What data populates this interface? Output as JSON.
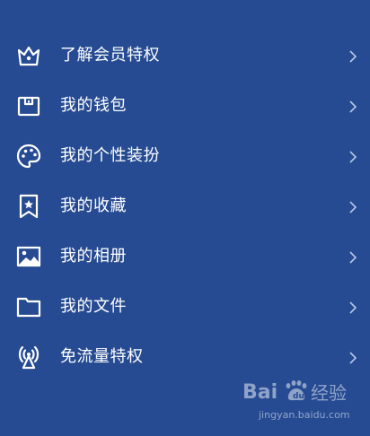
{
  "menu": {
    "items": [
      {
        "label": "了解会员特权",
        "icon": "crown-icon"
      },
      {
        "label": "我的钱包",
        "icon": "wallet-icon"
      },
      {
        "label": "我的个性装扮",
        "icon": "palette-icon"
      },
      {
        "label": "我的收藏",
        "icon": "bookmark-star-icon"
      },
      {
        "label": "我的相册",
        "icon": "image-icon"
      },
      {
        "label": "我的文件",
        "icon": "folder-icon"
      },
      {
        "label": "免流量特权",
        "icon": "broadcast-icon"
      }
    ]
  },
  "watermark": {
    "logo": "Bai 经验",
    "url": "jingyan.baidu.com"
  },
  "colors": {
    "background": "#264b92",
    "foreground": "#ffffff",
    "chevron": "#b7c6e6"
  }
}
